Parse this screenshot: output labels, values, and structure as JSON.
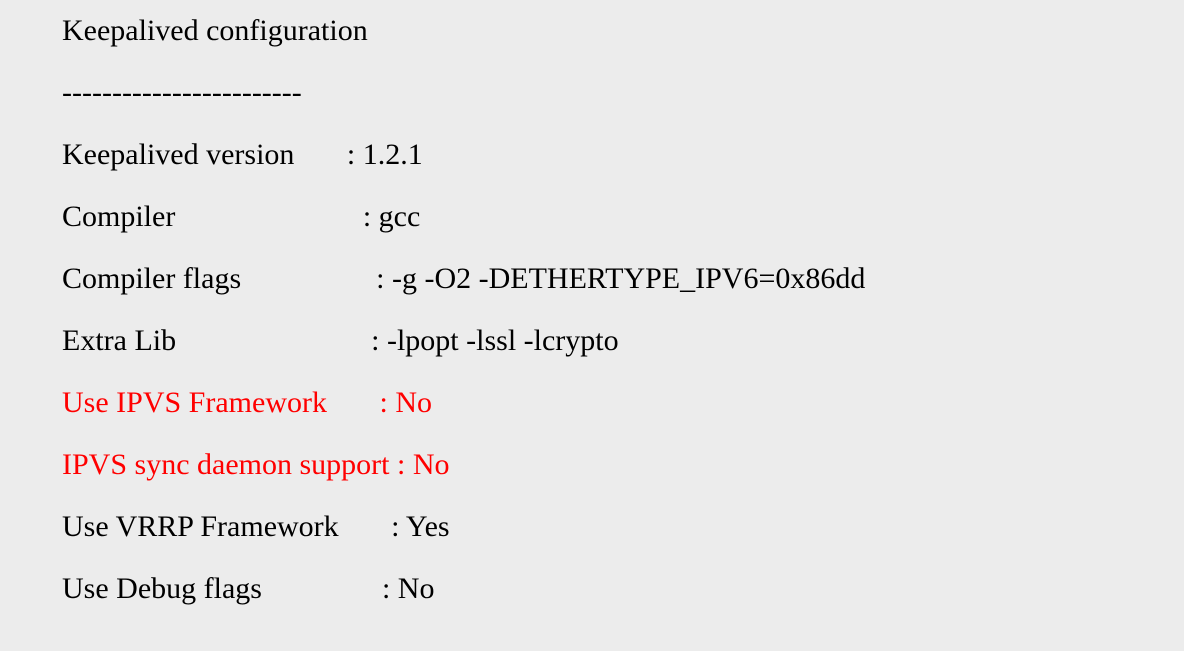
{
  "title": "Keepalived configuration",
  "separator": "------------------------",
  "rows": [
    {
      "label": "Keepalived version",
      "sep": "       : ",
      "value": "1.2.1",
      "red": false
    },
    {
      "label": "Compiler",
      "sep": "                         : ",
      "value": "gcc",
      "red": false
    },
    {
      "label": "Compiler flags",
      "sep": "                  : ",
      "value": "-g -O2 -DETHERTYPE_IPV6=0x86dd",
      "red": false
    },
    {
      "label": "Extra Lib",
      "sep": "                          : ",
      "value": "-lpopt -lssl -lcrypto",
      "red": false
    },
    {
      "label": "Use IPVS Framework",
      "sep": "       : ",
      "value": "No",
      "red": true
    },
    {
      "label": "IPVS sync daemon support",
      "sep": " : ",
      "value": "No",
      "red": true
    },
    {
      "label": "Use VRRP Framework",
      "sep": "       : ",
      "value": "Yes",
      "red": false
    },
    {
      "label": "Use Debug flags",
      "sep": "                : ",
      "value": "No",
      "red": false
    }
  ]
}
